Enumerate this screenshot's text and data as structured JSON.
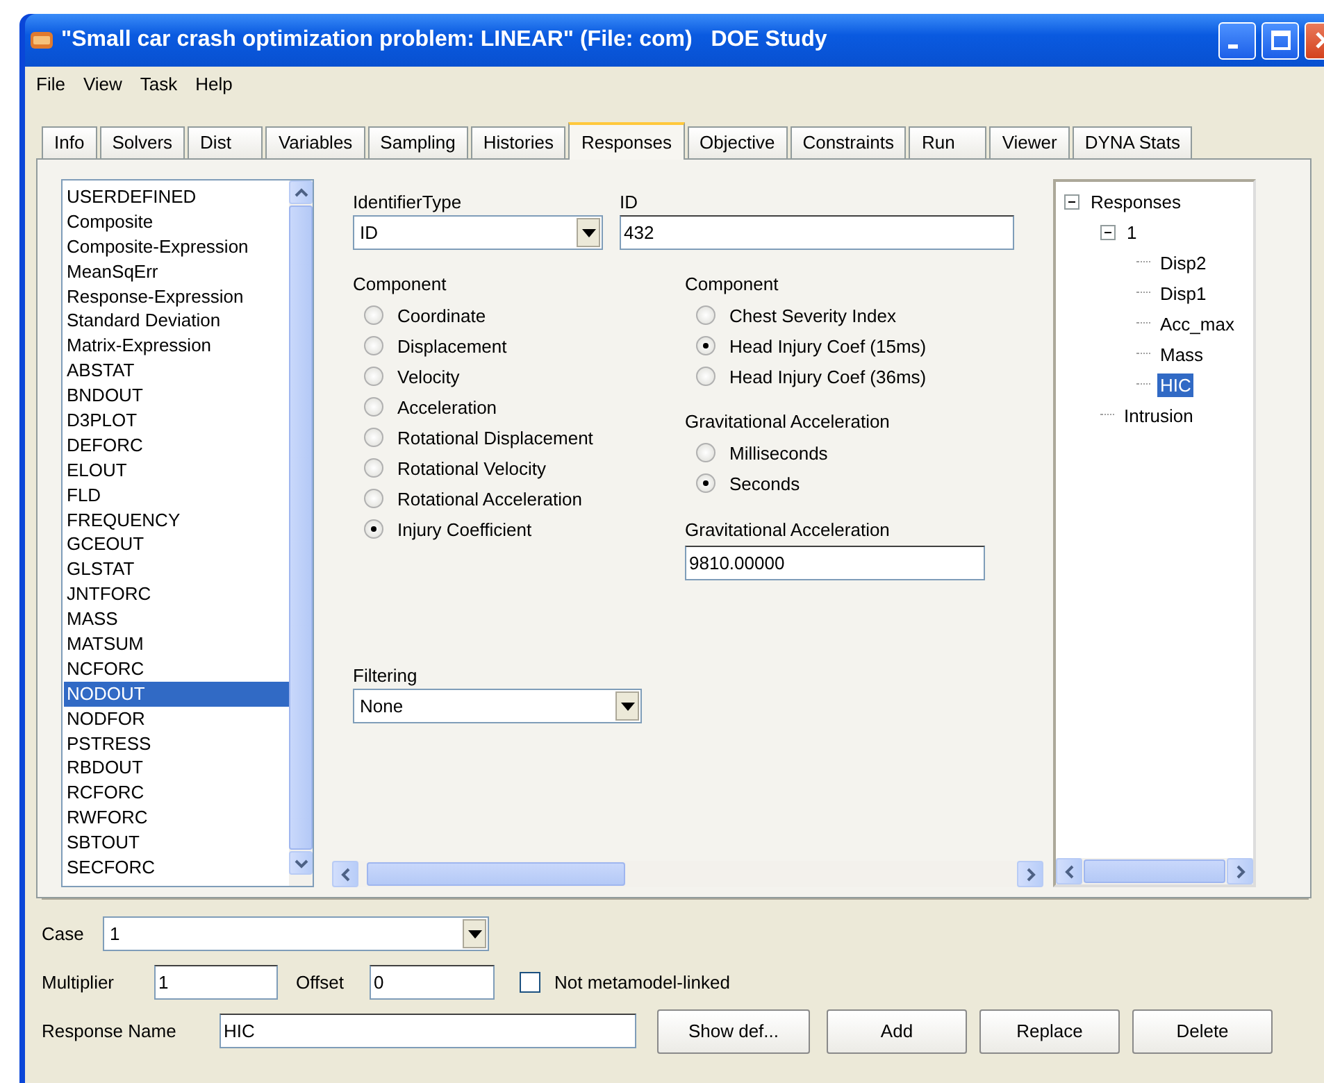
{
  "window": {
    "title": "\"Small car crash optimization problem: LINEAR\" (File: com)   DOE Study"
  },
  "menu": [
    "File",
    "View",
    "Task",
    "Help"
  ],
  "tabs": [
    {
      "label": "Info",
      "selected": false
    },
    {
      "label": "Solvers",
      "selected": false
    },
    {
      "label": "Dist",
      "selected": false
    },
    {
      "label": "Variables",
      "selected": false
    },
    {
      "label": "Sampling",
      "selected": false
    },
    {
      "label": "Histories",
      "selected": false
    },
    {
      "label": "Responses",
      "selected": true
    },
    {
      "label": "Objective",
      "selected": false
    },
    {
      "label": "Constraints",
      "selected": false
    },
    {
      "label": "Run",
      "selected": false
    },
    {
      "label": "Viewer",
      "selected": false
    },
    {
      "label": "DYNA Stats",
      "selected": false
    }
  ],
  "response_types": {
    "items": [
      {
        "label": "USERDEFINED",
        "selected": false
      },
      {
        "label": "Composite",
        "selected": false
      },
      {
        "label": "Composite-Expression",
        "selected": false
      },
      {
        "label": "MeanSqErr",
        "selected": false
      },
      {
        "label": "Response-Expression",
        "selected": false
      },
      {
        "label": "Standard Deviation",
        "selected": false
      },
      {
        "label": "Matrix-Expression",
        "selected": false
      },
      {
        "label": "ABSTAT",
        "selected": false
      },
      {
        "label": "BNDOUT",
        "selected": false
      },
      {
        "label": "D3PLOT",
        "selected": false
      },
      {
        "label": "DEFORC",
        "selected": false
      },
      {
        "label": "ELOUT",
        "selected": false
      },
      {
        "label": "FLD",
        "selected": false
      },
      {
        "label": "FREQUENCY",
        "selected": false
      },
      {
        "label": "GCEOUT",
        "selected": false
      },
      {
        "label": "GLSTAT",
        "selected": false
      },
      {
        "label": "JNTFORC",
        "selected": false
      },
      {
        "label": "MASS",
        "selected": false
      },
      {
        "label": "MATSUM",
        "selected": false
      },
      {
        "label": "NCFORC",
        "selected": false
      },
      {
        "label": "NODOUT",
        "selected": true
      },
      {
        "label": "NODFOR",
        "selected": false
      },
      {
        "label": "PSTRESS",
        "selected": false
      },
      {
        "label": "RBDOUT",
        "selected": false
      },
      {
        "label": "RCFORC",
        "selected": false
      },
      {
        "label": "RWFORC",
        "selected": false
      },
      {
        "label": "SBTOUT",
        "selected": false
      },
      {
        "label": "SECFORC",
        "selected": false
      }
    ]
  },
  "identifier_type": {
    "label": "IdentifierType",
    "value": "ID"
  },
  "id": {
    "label": "ID",
    "value": "432"
  },
  "component_left": {
    "label": "Component",
    "options": [
      {
        "label": "Coordinate",
        "selected": false
      },
      {
        "label": "Displacement",
        "selected": false
      },
      {
        "label": "Velocity",
        "selected": false
      },
      {
        "label": "Acceleration",
        "selected": false
      },
      {
        "label": "Rotational Displacement",
        "selected": false
      },
      {
        "label": "Rotational Velocity",
        "selected": false
      },
      {
        "label": "Rotational Acceleration",
        "selected": false
      },
      {
        "label": "Injury Coefficient",
        "selected": true
      }
    ]
  },
  "filtering": {
    "label": "Filtering",
    "value": "None"
  },
  "component_right": {
    "label": "Component",
    "options": [
      {
        "label": "Chest Severity Index",
        "selected": false
      },
      {
        "label": "Head Injury Coef (15ms)",
        "selected": true
      },
      {
        "label": "Head Injury Coef (36ms)",
        "selected": false
      }
    ]
  },
  "gravity_units": {
    "label": "Gravitational Acceleration",
    "options": [
      {
        "label": "Milliseconds",
        "selected": false
      },
      {
        "label": "Seconds",
        "selected": true
      }
    ]
  },
  "gravity_value": {
    "label": "Gravitational Acceleration",
    "value": "9810.00000"
  },
  "tree": {
    "items": [
      {
        "label": "Responses",
        "expanded": true,
        "selected": false,
        "children": [
          {
            "label": "1",
            "expanded": true,
            "selected": false,
            "children": [
              {
                "label": "Disp2",
                "selected": false
              },
              {
                "label": "Disp1",
                "selected": false
              },
              {
                "label": "Acc_max",
                "selected": false
              },
              {
                "label": "Mass",
                "selected": false
              },
              {
                "label": "HIC",
                "selected": true
              }
            ]
          },
          {
            "label": "Intrusion",
            "selected": false
          }
        ]
      }
    ]
  },
  "case": {
    "label": "Case",
    "value": "1"
  },
  "multiplier": {
    "label": "Multiplier",
    "value": "1"
  },
  "offset": {
    "label": "Offset",
    "value": "0"
  },
  "not_metamodel_linked": {
    "label": "Not metamodel-linked",
    "checked": false
  },
  "response_name": {
    "label": "Response Name",
    "value": "HIC"
  },
  "buttons": [
    "Show def...",
    "Add",
    "Replace",
    "Delete"
  ]
}
